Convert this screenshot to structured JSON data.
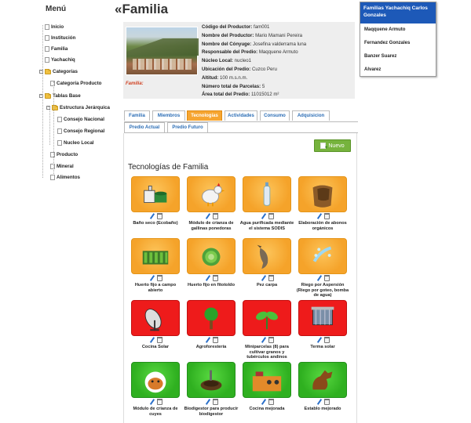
{
  "sidebar": {
    "title": "Menú",
    "items": [
      {
        "label": "Inicio"
      },
      {
        "label": "Institución"
      },
      {
        "label": "Familia"
      },
      {
        "label": "Yachachiq"
      },
      {
        "label": "Categorías"
      },
      {
        "label": "Categoría Producto"
      },
      {
        "label": "Tablas Base"
      },
      {
        "label": "Estructura Jerárquica"
      },
      {
        "label": "Consejo Nacional"
      },
      {
        "label": "Consejo Regional"
      },
      {
        "label": "Nucleo Local"
      },
      {
        "label": "Producto"
      },
      {
        "label": "Mineral"
      },
      {
        "label": "Alimentos"
      }
    ]
  },
  "page": {
    "title_mark": "«",
    "title": "Familia"
  },
  "producer": {
    "photo_caption": "Familia:",
    "fields": [
      {
        "label": "Código del Productor:",
        "value": "fam001"
      },
      {
        "label": "Nombre del Productor:",
        "value": "Mario Mamani Pereira"
      },
      {
        "label": "Nombre del Cónyuge:",
        "value": "Josefina valderrama luna"
      },
      {
        "label": "Responsable del Predio:",
        "value": "Maqquene Armuto"
      },
      {
        "label": "Núcleo Local:",
        "value": "nucleo1"
      },
      {
        "label": "Ubicación del Predio:",
        "value": "Cuzco Peru"
      },
      {
        "label": "Altitud:",
        "value": "100 m.s.n.m."
      },
      {
        "label": "Número total de Parcelas:",
        "value": "5"
      },
      {
        "label": "Área total del Predio:",
        "value": "11015012 m²"
      }
    ]
  },
  "families_panel": {
    "header": "Familias Yachachiq Carlos Gonzales",
    "items": [
      "Maqquene Armuto",
      "Fernandez Gonzales",
      "Banzer Suarez",
      "Alvarez"
    ]
  },
  "tabs": [
    {
      "label": "Familia"
    },
    {
      "label": "Miembros"
    },
    {
      "label": "Tecnologías",
      "active": true
    },
    {
      "label": "Actividades"
    },
    {
      "label": "Consumo"
    },
    {
      "label": "Adquisicion"
    },
    {
      "label": "Predio Actual"
    },
    {
      "label": "Predio Futuro"
    }
  ],
  "nuevo_label": "Nuevo",
  "section_title": "Tecnologías de Familia",
  "technologies": [
    {
      "name": "Baño seco (Ecobaño)",
      "color": "orange",
      "icon": "toilet-icon"
    },
    {
      "name": "Módulo de crianza de gallinas ponedoras",
      "color": "orange",
      "icon": "chicken-icon"
    },
    {
      "name": "Agua purificada mediante el sistema SODIS",
      "color": "orange",
      "icon": "water-bottle-icon"
    },
    {
      "name": "Elaboración de abonos orgánicos",
      "color": "orange",
      "icon": "compost-icon"
    },
    {
      "name": "Huerto fijo a campo abierto",
      "color": "orange",
      "icon": "garden-icon"
    },
    {
      "name": "Huerto fijo en fitotoldo",
      "color": "orange",
      "icon": "lettuce-icon"
    },
    {
      "name": "Pez carpa",
      "color": "orange",
      "icon": "fish-icon"
    },
    {
      "name": "Riego por Aspersión (Riego por goteo, bomba de agua)",
      "color": "orange",
      "icon": "sprinkler-icon"
    },
    {
      "name": "Cocina Solar",
      "color": "red",
      "icon": "solar-cooker-icon"
    },
    {
      "name": "Agroforestería",
      "color": "red",
      "icon": "tree-icon"
    },
    {
      "name": "Miniparcelas (8) para cultivar granos y tubérculos andinos",
      "color": "red",
      "icon": "sprout-icon"
    },
    {
      "name": "Terma solar",
      "color": "red",
      "icon": "solar-heater-icon"
    },
    {
      "name": "Módulo de crianza de cuyes",
      "color": "green",
      "icon": "guinea-pig-icon"
    },
    {
      "name": "Biodigestor para producir biodigestor",
      "color": "green",
      "icon": "biodigester-icon"
    },
    {
      "name": "Cocina mejorada",
      "color": "green",
      "icon": "kitchen-icon"
    },
    {
      "name": "Establo mejorado",
      "color": "green",
      "icon": "horse-icon"
    }
  ]
}
